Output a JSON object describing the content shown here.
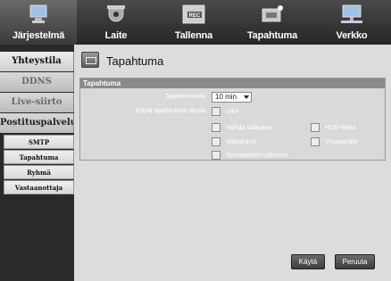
{
  "tabs": [
    {
      "label": "Järjestelmä",
      "icon": "monitor-icon",
      "active": true
    },
    {
      "label": "Laite",
      "icon": "camera-icon",
      "active": false
    },
    {
      "label": "Tallenna",
      "icon": "rec-icon",
      "active": false
    },
    {
      "label": "Tapahtuma",
      "icon": "event-icon",
      "active": false
    },
    {
      "label": "Verkko",
      "icon": "network-icon",
      "active": false
    }
  ],
  "sidebar": {
    "items": [
      {
        "label": "Yhteystila"
      },
      {
        "label": "DDNS"
      },
      {
        "label": "Live-siirto"
      },
      {
        "label": "Postituspalvelu"
      }
    ],
    "subitems": [
      {
        "label": "SMTP"
      },
      {
        "label": "Tapahtuma"
      },
      {
        "label": "Ryhmä"
      },
      {
        "label": "Vastaanottaja"
      }
    ]
  },
  "page": {
    "title": "Tapahtuma"
  },
  "event_group": {
    "header": "Tapahtuma",
    "interval_label": "Tapahtumaväli",
    "interval_value": "10 min",
    "transfer_label": "Käytä tapahtuman siirtoa",
    "checkboxes": [
      {
        "label": "Liike"
      },
      {
        "label": "Vaihda salasana"
      },
      {
        "label": "HDD-tiedot"
      },
      {
        "label": "Videohäviö"
      },
      {
        "label": "Virtapainike"
      },
      {
        "label": "Manuaalinen tallennus"
      }
    ]
  },
  "buttons": {
    "apply": "Käytä",
    "cancel": "Peruuta"
  }
}
